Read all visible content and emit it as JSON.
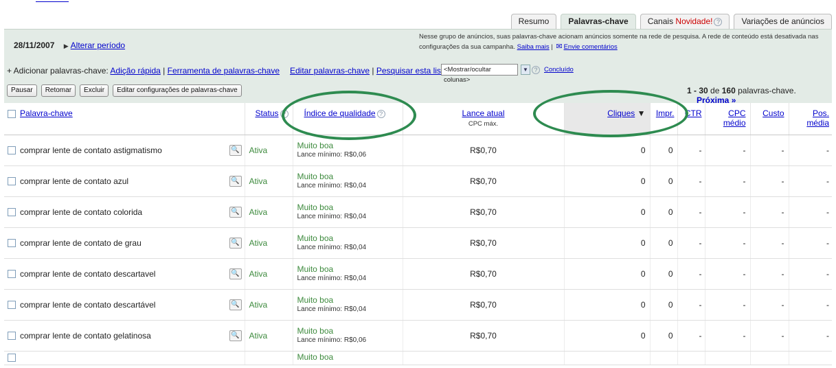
{
  "tabs": [
    {
      "label": "Resumo"
    },
    {
      "label": "Palavras-chave"
    },
    {
      "label": "Canais",
      "badge": "Novidade!"
    },
    {
      "label": "Variações de anúncios"
    }
  ],
  "header": {
    "date": "28/11/2007",
    "change_period": "Alterar período",
    "notice": "Nesse grupo de anúncios, suas palavras-chave acionam anúncios somente na rede de pesquisa. A rede de conteúdo está desativada nas configurações da sua campanha.",
    "learn_more": "Saiba mais",
    "feedback": "Envie comentários"
  },
  "toolbar": {
    "add_prefix": "+ Adicionar palavras-chave:",
    "quick_add": "Adição rápida",
    "kw_tool": "Ferramenta de palavras-chave",
    "edit_kw": "Editar palavras-chave",
    "search_list": "Pesquisar esta lista",
    "columns_select": "<Mostrar/ocultar colunas>",
    "done": "Concluído",
    "pause": "Pausar",
    "resume": "Retomar",
    "delete": "Excluir",
    "edit_settings": "Editar configurações de palavras-chave",
    "paging_range": "1 - 30",
    "paging_of": "de",
    "paging_total": "160",
    "paging_suffix": "palavras-chave.",
    "next": "Próxima »"
  },
  "table": {
    "headers": {
      "keyword": "Palavra-chave",
      "status": "Status",
      "quality": "Índice de qualidade",
      "bid": "Lance atual",
      "bid_sub": "CPC máx.",
      "clicks": "Cliques",
      "impr": "Impr.",
      "ctr": "CTR",
      "cpc": "CPC médio",
      "cost": "Custo",
      "pos": "Pos. média"
    },
    "rows": [
      {
        "keyword": "comprar lente de contato astigmatismo",
        "status": "Ativa",
        "quality": "Muito boa",
        "min_bid": "Lance mínimo: R$0,06",
        "bid": "R$0,70",
        "clicks": "0",
        "impr": "0",
        "ctr": "-",
        "cpc": "-",
        "cost": "-",
        "pos": "-"
      },
      {
        "keyword": "comprar lente de contato azul",
        "status": "Ativa",
        "quality": "Muito boa",
        "min_bid": "Lance mínimo: R$0,04",
        "bid": "R$0,70",
        "clicks": "0",
        "impr": "0",
        "ctr": "-",
        "cpc": "-",
        "cost": "-",
        "pos": "-"
      },
      {
        "keyword": "comprar lente de contato colorida",
        "status": "Ativa",
        "quality": "Muito boa",
        "min_bid": "Lance mínimo: R$0,04",
        "bid": "R$0,70",
        "clicks": "0",
        "impr": "0",
        "ctr": "-",
        "cpc": "-",
        "cost": "-",
        "pos": "-"
      },
      {
        "keyword": "comprar lente de contato de grau",
        "status": "Ativa",
        "quality": "Muito boa",
        "min_bid": "Lance mínimo: R$0,04",
        "bid": "R$0,70",
        "clicks": "0",
        "impr": "0",
        "ctr": "-",
        "cpc": "-",
        "cost": "-",
        "pos": "-"
      },
      {
        "keyword": "comprar lente de contato descartavel",
        "status": "Ativa",
        "quality": "Muito boa",
        "min_bid": "Lance mínimo: R$0,04",
        "bid": "R$0,70",
        "clicks": "0",
        "impr": "0",
        "ctr": "-",
        "cpc": "-",
        "cost": "-",
        "pos": "-"
      },
      {
        "keyword": "comprar lente de contato descartável",
        "status": "Ativa",
        "quality": "Muito boa",
        "min_bid": "Lance mínimo: R$0,04",
        "bid": "R$0,70",
        "clicks": "0",
        "impr": "0",
        "ctr": "-",
        "cpc": "-",
        "cost": "-",
        "pos": "-"
      },
      {
        "keyword": "comprar lente de contato gelatinosa",
        "status": "Ativa",
        "quality": "Muito boa",
        "min_bid": "Lance mínimo: R$0,06",
        "bid": "R$0,70",
        "clicks": "0",
        "impr": "0",
        "ctr": "-",
        "cpc": "-",
        "cost": "-",
        "pos": "-"
      }
    ],
    "partial_quality": "Muito boa"
  },
  "colors": {
    "accent_panel": "#e3ebe6",
    "link": "#0000cc",
    "status_green": "#3d8a3d",
    "highlight_oval": "#2e8b50"
  },
  "icons": {
    "help": "question-mark-icon",
    "envelope": "envelope-icon",
    "search": "magnifier-icon",
    "sort": "sort-down-icon"
  }
}
